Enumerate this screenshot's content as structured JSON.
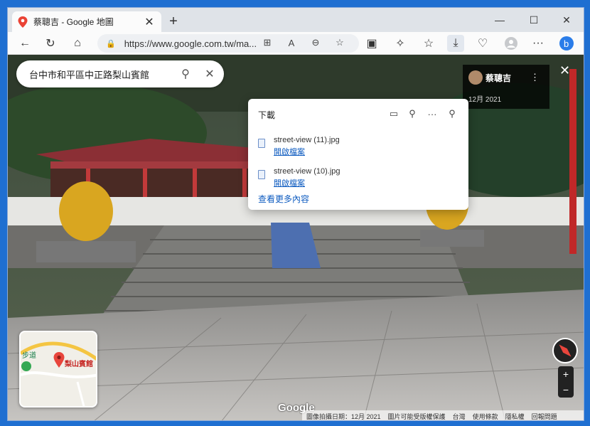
{
  "browser": {
    "tab_title": "蔡聰吉 - Google 地圖",
    "new_tab_icon": "plus-icon",
    "url": "https://www.google.com.tw/ma...",
    "minimize_icon": "minimize-icon",
    "maximize_icon": "maximize-icon",
    "close_icon": "close-icon"
  },
  "search": {
    "value": "台中市和平區中正路梨山賓館"
  },
  "photographer": {
    "name": "蔡聰吉",
    "date": "12月 2021"
  },
  "downloads": {
    "title": "下載",
    "items": [
      {
        "filename": "street-view (11).jpg",
        "action": "開啟檔案"
      },
      {
        "filename": "street-view (10).jpg",
        "action": "開啟檔案"
      }
    ],
    "see_more": "查看更多內容"
  },
  "minimap": {
    "trail_label": "步道",
    "place_label": "梨山賓館"
  },
  "map": {
    "google_logo": "Google",
    "footer": [
      "圖像拍攝日期：12月 2021",
      "圖片可能受版權保護",
      "台灣",
      "使用條款",
      "隱私權",
      "回報問題"
    ]
  },
  "colors": {
    "accent": "#0f5cc0",
    "window_border": "#1f6fd1"
  }
}
